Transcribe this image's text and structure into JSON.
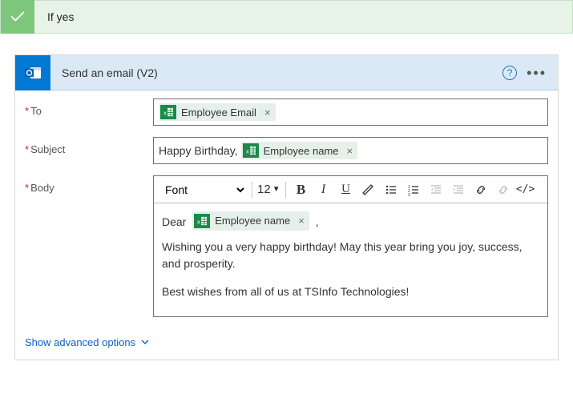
{
  "condition": {
    "title": "If yes"
  },
  "action": {
    "title": "Send an email (V2)",
    "help_tooltip": "?",
    "fields": {
      "to": {
        "label": "To",
        "required": true,
        "tokens": [
          "Employee Email"
        ]
      },
      "subject": {
        "label": "Subject",
        "required": true,
        "prefix": "Happy Birthday,",
        "tokens": [
          "Employee name"
        ]
      },
      "body": {
        "label": "Body",
        "required": true,
        "toolbar": {
          "font": "Font",
          "size": "12",
          "buttons": [
            "bold",
            "italic",
            "underline",
            "color",
            "bullet-list",
            "number-list",
            "outdent",
            "indent",
            "link",
            "clear",
            "code"
          ]
        },
        "greeting_prefix": "Dear",
        "greeting_token": "Employee name",
        "greeting_suffix": ",",
        "paragraph1": "Wishing you a very happy birthday! May this year bring you joy, success, and prosperity.",
        "paragraph2": "Best wishes from all of us at TSInfo Technologies!"
      }
    },
    "advanced": "Show advanced options"
  }
}
